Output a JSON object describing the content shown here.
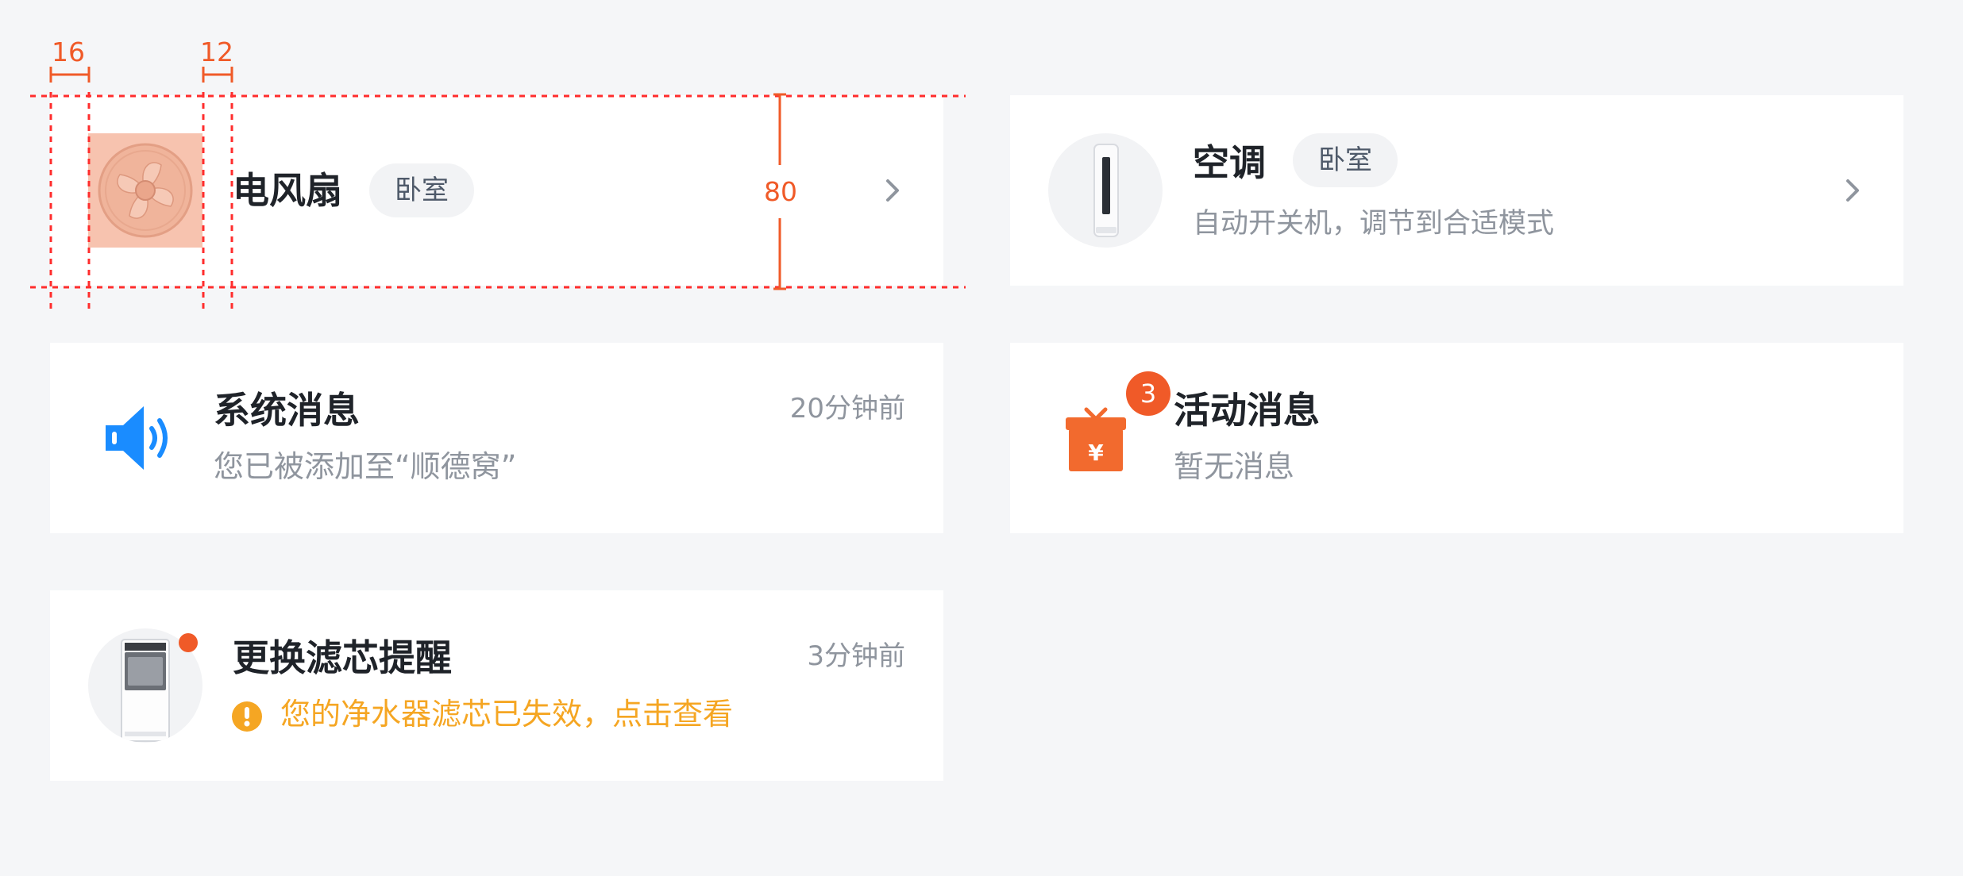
{
  "annotations": {
    "dim_left": "16",
    "dim_gap": "12",
    "dim_height": "80",
    "color": "#f05a28"
  },
  "cards": {
    "fan": {
      "title": "电风扇",
      "tag": "卧室",
      "icon": "fan-icon"
    },
    "ac": {
      "title": "空调",
      "tag": "卧室",
      "subtitle": "自动开关机，调节到合适模式",
      "icon": "air-conditioner-icon"
    },
    "system": {
      "title": "系统消息",
      "subtitle": "您已被添加至“顺德窝”",
      "time": "20分钟前",
      "icon": "speaker-icon",
      "icon_color": "#1a8cff"
    },
    "activity": {
      "title": "活动消息",
      "subtitle": "暂无消息",
      "badge": "3",
      "icon": "gift-icon",
      "icon_color": "#f26a2e"
    },
    "filter": {
      "title": "更换滤芯提醒",
      "warning": "您的净水器滤芯已失效，点击查看",
      "time": "3分钟前",
      "icon": "water-purifier-icon",
      "warning_color": "#f5a623"
    }
  }
}
